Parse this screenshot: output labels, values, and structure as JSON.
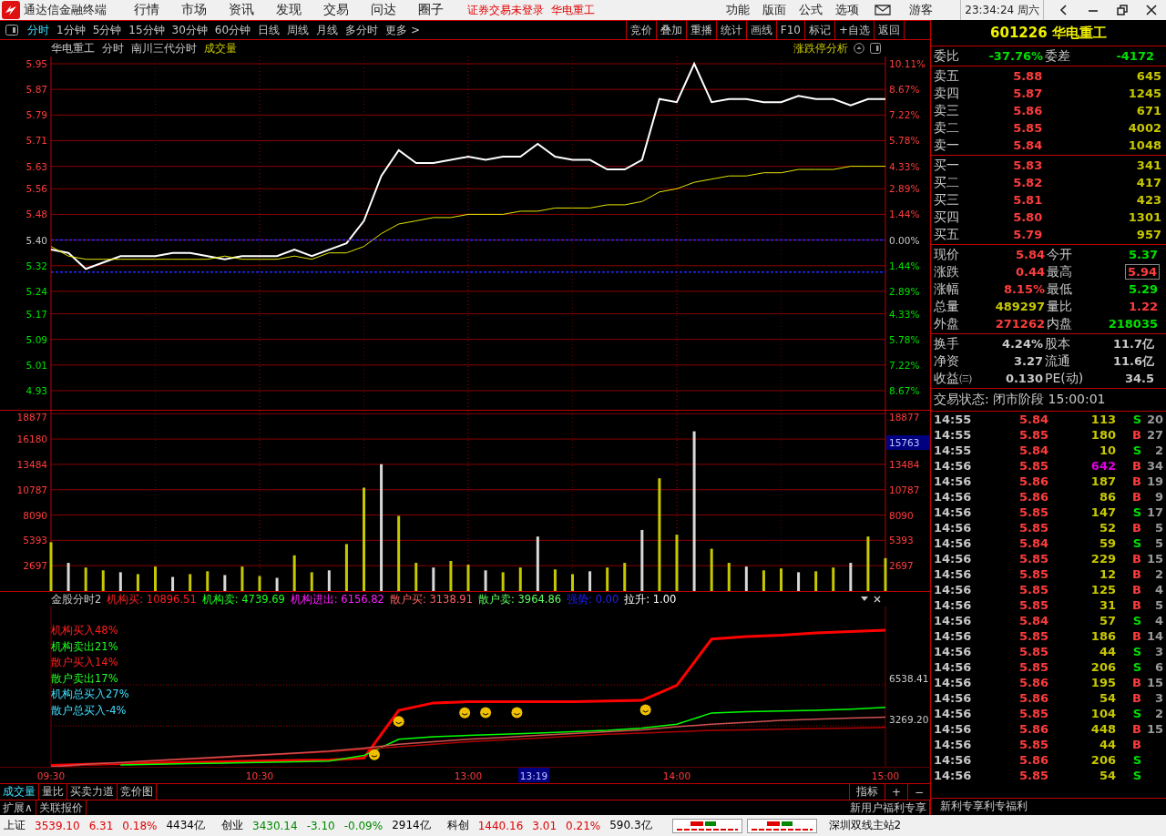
{
  "menubar": {
    "app_title": "通达信金融终端",
    "menus": [
      "行情",
      "市场",
      "资讯",
      "发现",
      "交易",
      "问达",
      "圈子"
    ],
    "notice": "证券交易未登录",
    "stock_name": "华电重工",
    "right_menus": [
      "功能",
      "版面",
      "公式",
      "选项"
    ],
    "user": "游客",
    "clock": "23:34:24 周六"
  },
  "toolbar": {
    "tabs": [
      {
        "label": "分时",
        "selected": true
      },
      {
        "label": "1分钟",
        "selected": false
      },
      {
        "label": "5分钟",
        "selected": false
      },
      {
        "label": "15分钟",
        "selected": false
      },
      {
        "label": "30分钟",
        "selected": false
      },
      {
        "label": "60分钟",
        "selected": false
      },
      {
        "label": "日线",
        "selected": false
      },
      {
        "label": "周线",
        "selected": false
      },
      {
        "label": "月线",
        "selected": false
      },
      {
        "label": "多分时",
        "selected": false
      },
      {
        "label": "更多 >",
        "selected": false
      }
    ],
    "buttons": [
      "竞价",
      "叠加",
      "重播",
      "统计",
      "画线",
      "F10",
      "标记",
      "+自选",
      "返回"
    ]
  },
  "price_panel": {
    "header": [
      {
        "text": "华电重工",
        "kind": "title"
      },
      {
        "text": "分时",
        "kind": "title"
      },
      {
        "text": "南川三代分时",
        "kind": "title"
      },
      {
        "text": "成交量",
        "kind": "indicator"
      }
    ],
    "limit_analysis": "涨跌停分析",
    "right_labels": [
      {
        "text": "10.11%",
        "color": "#ff3c3c"
      },
      {
        "text": "8.67%",
        "color": "#ff3c3c"
      },
      {
        "text": "7.22%",
        "color": "#ff3c3c"
      },
      {
        "text": "5.78%",
        "color": "#ff3c3c"
      },
      {
        "text": "4.33%",
        "color": "#ff3c3c"
      },
      {
        "text": "2.89%",
        "color": "#ff3c3c"
      },
      {
        "text": "1.44%",
        "color": "#ff3c3c"
      },
      {
        "text": "0.00%",
        "color": "#c8c8c8"
      },
      {
        "text": "1.44%",
        "color": "#00e000"
      },
      {
        "text": "2.89%",
        "color": "#00e000"
      },
      {
        "text": "4.33%",
        "color": "#00e000"
      },
      {
        "text": "5.78%",
        "color": "#00e000"
      },
      {
        "text": "7.22%",
        "color": "#00e000"
      },
      {
        "text": "8.67%",
        "color": "#00e000"
      }
    ],
    "chart_data": {
      "type": "line",
      "grid": true,
      "series": [
        {
          "color": "#ffffff",
          "values": [
            5.37,
            5.36,
            5.31,
            5.33,
            5.35,
            5.35,
            5.35,
            5.36,
            5.36,
            5.35,
            5.34,
            5.35,
            5.35,
            5.35,
            5.37,
            5.35,
            5.37,
            5.39,
            5.46,
            5.6,
            5.68,
            5.64,
            5.64,
            5.65,
            5.66,
            5.65,
            5.66,
            5.66,
            5.7,
            5.66,
            5.65,
            5.65,
            5.62,
            5.62,
            5.65,
            5.84,
            5.83,
            5.95,
            5.83,
            5.84,
            5.84,
            5.83,
            5.83,
            5.85,
            5.84,
            5.84,
            5.82,
            5.84,
            5.84
          ]
        },
        {
          "color": "#e6e600",
          "values": [
            5.38,
            5.35,
            5.34,
            5.34,
            5.34,
            5.34,
            5.34,
            5.34,
            5.34,
            5.34,
            5.35,
            5.34,
            5.34,
            5.34,
            5.35,
            5.34,
            5.36,
            5.36,
            5.38,
            5.42,
            5.45,
            5.46,
            5.47,
            5.47,
            5.48,
            5.48,
            5.48,
            5.49,
            5.49,
            5.5,
            5.5,
            5.5,
            5.51,
            5.51,
            5.52,
            5.55,
            5.56,
            5.58,
            5.59,
            5.6,
            5.6,
            5.61,
            5.61,
            5.62,
            5.62,
            5.62,
            5.63,
            5.63,
            5.63
          ]
        },
        {
          "color": "#2a2aff",
          "line_style": "dashed",
          "values": [
            5.4,
            5.4,
            5.4,
            5.4,
            5.4,
            5.4,
            5.4,
            5.4,
            5.4,
            5.4,
            5.4,
            5.4,
            5.4,
            5.4,
            5.4,
            5.4,
            5.4,
            5.4,
            5.4,
            5.4,
            5.4,
            5.4,
            5.4,
            5.4,
            5.4,
            5.4,
            5.4,
            5.4,
            5.4,
            5.4,
            5.4,
            5.4,
            5.4,
            5.4,
            5.4,
            5.4,
            5.4,
            5.4,
            5.4,
            5.4,
            5.4,
            5.4,
            5.4,
            5.4,
            5.4,
            5.4,
            5.4,
            5.4,
            5.4
          ]
        },
        {
          "color": "#2a2aff",
          "line_style": "dashed",
          "values": [
            5.3,
            5.3,
            5.3,
            5.3,
            5.3,
            5.3,
            5.3,
            5.3,
            5.3,
            5.3,
            5.3,
            5.3,
            5.3,
            5.3,
            5.3,
            5.3,
            5.3,
            5.3,
            5.3,
            5.3,
            5.3,
            5.3,
            5.3,
            5.3,
            5.3,
            5.3,
            5.3,
            5.3,
            5.3,
            5.3,
            5.3,
            5.3,
            5.3,
            5.3,
            5.3,
            5.3,
            5.3,
            5.3,
            5.3,
            5.3,
            5.3,
            5.3,
            5.3,
            5.3,
            5.3,
            5.3,
            5.3,
            5.3,
            5.3
          ]
        }
      ],
      "ylim": [
        4.93,
        5.95
      ],
      "yticks": [
        {
          "value": 5.95,
          "label": "5.95"
        },
        {
          "value": 5.87,
          "label": "5.87"
        },
        {
          "value": 5.79,
          "label": "5.79"
        },
        {
          "value": 5.71,
          "label": "5.71"
        },
        {
          "value": 5.63,
          "label": "5.63"
        },
        {
          "value": 5.56,
          "label": "5.56"
        },
        {
          "value": 5.48,
          "label": "5.48"
        },
        {
          "value": 5.4,
          "label": "5.40"
        },
        {
          "value": 5.32,
          "label": "5.32"
        },
        {
          "value": 5.24,
          "label": "5.24"
        },
        {
          "value": 5.17,
          "label": "5.17"
        },
        {
          "value": 5.09,
          "label": "5.09"
        },
        {
          "value": 5.01,
          "label": "5.01"
        },
        {
          "value": 4.93,
          "label": "4.93"
        }
      ]
    }
  },
  "volume_panel": {
    "cursor_value": "15763",
    "chart_data": {
      "type": "bar",
      "grid": true,
      "series": [
        {
          "color": "#c8c800",
          "values": [
            5200,
            null,
            2500,
            2200,
            null,
            1800,
            2600,
            null,
            1800,
            2100,
            null,
            2600,
            1600,
            null,
            3800,
            2000,
            null,
            5000,
            11000,
            null,
            8000,
            3000,
            null,
            3200,
            2800,
            null,
            2000,
            2500,
            null,
            2300,
            1800,
            null,
            2500,
            3000,
            null,
            12000,
            6000,
            null,
            4500,
            3000,
            null,
            2200,
            2400,
            null,
            2100,
            2500,
            null,
            5800,
            3500
          ]
        },
        {
          "color": "#d8d8d8",
          "values": [
            null,
            3000,
            null,
            null,
            2000,
            null,
            null,
            1500,
            null,
            null,
            1700,
            null,
            null,
            1400,
            null,
            null,
            2200,
            null,
            null,
            13500,
            null,
            null,
            2500,
            null,
            null,
            2200,
            null,
            null,
            5800,
            null,
            null,
            2100,
            null,
            null,
            6500,
            null,
            null,
            17000,
            null,
            null,
            2600,
            null,
            null,
            2000,
            null,
            null,
            3000,
            null,
            null
          ]
        }
      ],
      "ylim": [
        0,
        19000
      ],
      "yticks": [
        {
          "value": 18877,
          "label": "18877"
        },
        {
          "value": 16180,
          "label": "16180"
        },
        {
          "value": 13484,
          "label": "13484"
        },
        {
          "value": 10787,
          "label": "10787"
        },
        {
          "value": 8090,
          "label": "8090"
        },
        {
          "value": 5393,
          "label": "5393"
        },
        {
          "value": 2697,
          "label": "2697"
        }
      ]
    }
  },
  "indicator_panel": {
    "name": "金股分时2",
    "readouts": [
      {
        "label": "机构买:",
        "value": "10896.51",
        "color": "#ff2020"
      },
      {
        "label": "机构卖:",
        "value": "4739.69",
        "color": "#20ff20"
      },
      {
        "label": "机构进出:",
        "value": "6156.82",
        "color": "#ff20ff"
      },
      {
        "label": "散户买:",
        "value": "3138.91",
        "color": "#ff6060"
      },
      {
        "label": "散户卖:",
        "value": "3964.86",
        "color": "#60ff60"
      },
      {
        "label": "强势:",
        "value": "0.00",
        "color": "#2020ff"
      },
      {
        "label": "拉升:",
        "value": "1.00",
        "color": "#ffffff"
      }
    ],
    "legend": [
      {
        "text": "机构买入48%",
        "color": "#ff2020"
      },
      {
        "text": "机构卖出21%",
        "color": "#20ff20"
      },
      {
        "text": "散户买入14%",
        "color": "#ff2121"
      },
      {
        "text": "散户卖出17%",
        "color": "#21ff21"
      },
      {
        "text": "机构总买入27%",
        "color": "#40e0ff"
      },
      {
        "text": "散户总买入-4%",
        "color": "#41e0ff"
      }
    ],
    "cursor_time": "13:19",
    "chart_data": {
      "type": "line",
      "categories": [
        "09:30",
        null,
        null,
        null,
        null,
        null,
        "10:30",
        null,
        null,
        null,
        null,
        null,
        "13:00",
        null,
        null,
        null,
        null,
        null,
        "14:00",
        null,
        null,
        null,
        null,
        null,
        "15:00"
      ],
      "series": [
        {
          "color": "#ff0000",
          "values": [
            100,
            200,
            250,
            300,
            350,
            400,
            450,
            500,
            550,
            700,
            4500,
            5100,
            5200,
            5200,
            5200,
            5200,
            5250,
            5300,
            6500,
            10200,
            10400,
            10500,
            10700,
            10800,
            10900
          ]
        },
        {
          "color": "#00ff00",
          "values": [
            null,
            null,
            150,
            200,
            250,
            300,
            350,
            400,
            450,
            900,
            2200,
            2400,
            2500,
            2600,
            2700,
            2800,
            2900,
            3100,
            3400,
            4300,
            4400,
            4450,
            4500,
            4600,
            4740
          ]
        },
        {
          "color": "#b00000",
          "values": [
            0,
            150,
            300,
            450,
            600,
            750,
            900,
            1050,
            1200,
            1400,
            1600,
            1800,
            2000,
            2150,
            2300,
            2450,
            2600,
            2700,
            2800,
            2900,
            2950,
            3000,
            3050,
            3100,
            3140
          ]
        },
        {
          "color": "#d05050",
          "values": [
            0,
            200,
            350,
            500,
            650,
            800,
            950,
            1100,
            1250,
            1500,
            1800,
            2000,
            2200,
            2350,
            2500,
            2650,
            2800,
            2950,
            3200,
            3400,
            3550,
            3700,
            3800,
            3900,
            3960
          ]
        }
      ],
      "ylim": [
        0,
        12800
      ],
      "yticks": [
        {
          "value": 3269.2,
          "label": "3269.20"
        },
        {
          "value": 6538.41,
          "label": "6538.41"
        }
      ]
    }
  },
  "bottom_tabs": [
    {
      "label": "成交量",
      "selected": true
    },
    {
      "label": "量比",
      "selected": false
    },
    {
      "label": "买卖力道",
      "selected": false
    },
    {
      "label": "竞价图",
      "selected": false
    }
  ],
  "bottom_tools": [
    "指标",
    "+",
    "−"
  ],
  "extension": {
    "items": [
      "扩展∧",
      "关联报价"
    ],
    "promo": "新用户福利专享"
  },
  "quote": {
    "code": "601226",
    "name": "华电重工",
    "ratio": [
      {
        "label": "委比",
        "value": "-37.76%",
        "color": "#00e000"
      },
      {
        "label": "委差",
        "value": "-4172",
        "color": "#00e001"
      }
    ],
    "asks": [
      {
        "label": "卖五",
        "price": "5.88",
        "volume": "645"
      },
      {
        "label": "卖四",
        "price": "5.87",
        "volume": "1245"
      },
      {
        "label": "卖三",
        "price": "5.86",
        "volume": "671"
      },
      {
        "label": "卖二",
        "price": "5.85",
        "volume": "4002"
      },
      {
        "label": "卖一",
        "price": "5.84",
        "volume": "1048"
      }
    ],
    "bids": [
      {
        "label": "买一",
        "price": "5.83",
        "volume": "341"
      },
      {
        "label": "买二",
        "price": "5.82",
        "volume": "417"
      },
      {
        "label": "买三",
        "price": "5.81",
        "volume": "423"
      },
      {
        "label": "买四",
        "price": "5.80",
        "volume": "1301"
      },
      {
        "label": "买五",
        "price": "5.79",
        "volume": "957"
      }
    ],
    "stats": [
      [
        {
          "label": "现价",
          "value": "5.84",
          "color": "#ff3c3c",
          "boxed": false
        },
        {
          "label": "今开",
          "value": "5.37",
          "color": "#00e000",
          "boxed": false
        }
      ],
      [
        {
          "label": "涨跌",
          "value": "0.44",
          "color": "#ff3c3c",
          "boxed": false
        },
        {
          "label": "最高",
          "value": "5.94",
          "color": "#ff3c3c",
          "boxed": true
        }
      ],
      [
        {
          "label": "涨幅",
          "value": "8.15%",
          "color": "#ff3c3c",
          "boxed": false
        },
        {
          "label": "最低",
          "value": "5.29",
          "color": "#00e000",
          "boxed": false
        }
      ],
      [
        {
          "label": "总量",
          "value": "489297",
          "color": "#c8c800",
          "boxed": false
        },
        {
          "label": "量比",
          "value": "1.22",
          "color": "#ff3c3c",
          "boxed": false
        }
      ],
      [
        {
          "label": "外盘",
          "value": "271262",
          "color": "#ff3c3c",
          "boxed": false
        },
        {
          "label": "内盘",
          "value": "218035",
          "color": "#00e000",
          "boxed": false
        }
      ]
    ],
    "fundamentals": [
      [
        {
          "label": "换手",
          "value": "4.24%"
        },
        {
          "label": "股本",
          "value": "11.7亿"
        }
      ],
      [
        {
          "label": "净资",
          "value": "3.27"
        },
        {
          "label": "流通",
          "value": "11.6亿"
        }
      ],
      [
        {
          "label": "收益㈢",
          "value": "0.130"
        },
        {
          "label": "PE(动)",
          "value": "34.5"
        }
      ]
    ],
    "status": "交易状态: 闭市阶段 15:00:01"
  },
  "trades": [
    {
      "time": "14:55",
      "price": "5.84",
      "volume": "113",
      "large": false,
      "side": "S",
      "kind": "sell",
      "count": "20"
    },
    {
      "time": "14:55",
      "price": "5.85",
      "volume": "180",
      "large": false,
      "side": "B",
      "kind": "buy",
      "count": "27"
    },
    {
      "time": "14:55",
      "price": "5.84",
      "volume": "10",
      "large": false,
      "side": "S",
      "kind": "sell",
      "count": "2"
    },
    {
      "time": "14:56",
      "price": "5.85",
      "volume": "642",
      "large": true,
      "side": "B",
      "kind": "buy",
      "count": "34"
    },
    {
      "time": "14:56",
      "price": "5.86",
      "volume": "187",
      "large": false,
      "side": "B",
      "kind": "buy",
      "count": "19"
    },
    {
      "time": "14:56",
      "price": "5.86",
      "volume": "86",
      "large": false,
      "side": "B",
      "kind": "buy",
      "count": "9"
    },
    {
      "time": "14:56",
      "price": "5.85",
      "volume": "147",
      "large": false,
      "side": "S",
      "kind": "sell",
      "count": "17"
    },
    {
      "time": "14:56",
      "price": "5.85",
      "volume": "52",
      "large": false,
      "side": "B",
      "kind": "buy",
      "count": "5"
    },
    {
      "time": "14:56",
      "price": "5.84",
      "volume": "59",
      "large": false,
      "side": "S",
      "kind": "sell",
      "count": "5"
    },
    {
      "time": "14:56",
      "price": "5.85",
      "volume": "229",
      "large": false,
      "side": "B",
      "kind": "buy",
      "count": "15"
    },
    {
      "time": "14:56",
      "price": "5.85",
      "volume": "12",
      "large": false,
      "side": "B",
      "kind": "buy",
      "count": "2"
    },
    {
      "time": "14:56",
      "price": "5.85",
      "volume": "125",
      "large": false,
      "side": "B",
      "kind": "buy",
      "count": "4"
    },
    {
      "time": "14:56",
      "price": "5.85",
      "volume": "31",
      "large": false,
      "side": "B",
      "kind": "buy",
      "count": "5"
    },
    {
      "time": "14:56",
      "price": "5.84",
      "volume": "57",
      "large": false,
      "side": "S",
      "kind": "sell",
      "count": "4"
    },
    {
      "time": "14:56",
      "price": "5.85",
      "volume": "186",
      "large": false,
      "side": "B",
      "kind": "buy",
      "count": "14"
    },
    {
      "time": "14:56",
      "price": "5.85",
      "volume": "44",
      "large": false,
      "side": "S",
      "kind": "sell",
      "count": "3"
    },
    {
      "time": "14:56",
      "price": "5.85",
      "volume": "206",
      "large": false,
      "side": "S",
      "kind": "sell",
      "count": "6"
    },
    {
      "time": "14:56",
      "price": "5.86",
      "volume": "195",
      "large": false,
      "side": "B",
      "kind": "buy",
      "count": "15"
    },
    {
      "time": "14:56",
      "price": "5.86",
      "volume": "54",
      "large": false,
      "side": "B",
      "kind": "buy",
      "count": "3"
    },
    {
      "time": "14:56",
      "price": "5.85",
      "volume": "104",
      "large": false,
      "side": "S",
      "kind": "sell",
      "count": "2"
    },
    {
      "time": "14:56",
      "price": "5.86",
      "volume": "448",
      "large": false,
      "side": "B",
      "kind": "buy",
      "count": "15"
    },
    {
      "time": "14:56",
      "price": "5.85",
      "volume": "44",
      "large": false,
      "side": "B",
      "kind": "buy"
    },
    {
      "time": "14:56",
      "price": "5.86",
      "volume": "206",
      "large": false,
      "side": "S",
      "kind": "sell"
    },
    {
      "time": "14:56",
      "price": "5.85",
      "volume": "54",
      "large": false,
      "side": "S",
      "kind": "sell"
    }
  ],
  "ticker": "新利专享利专福利",
  "status_bar": {
    "indices": [
      {
        "name": "上证",
        "value": "3539.10",
        "change": "6.31",
        "percent": "0.18%",
        "amount": "4434亿",
        "color": "#e00000"
      },
      {
        "name": "创业",
        "value": "3430.14",
        "change": "-3.10",
        "percent": "-0.09%",
        "amount": "2914亿",
        "color": "#008800"
      },
      {
        "name": "科创",
        "value": "1440.16",
        "change": "3.01",
        "percent": "0.21%",
        "amount": "590.3亿",
        "color": "#e00001"
      }
    ],
    "server": "深圳双线主站2"
  }
}
